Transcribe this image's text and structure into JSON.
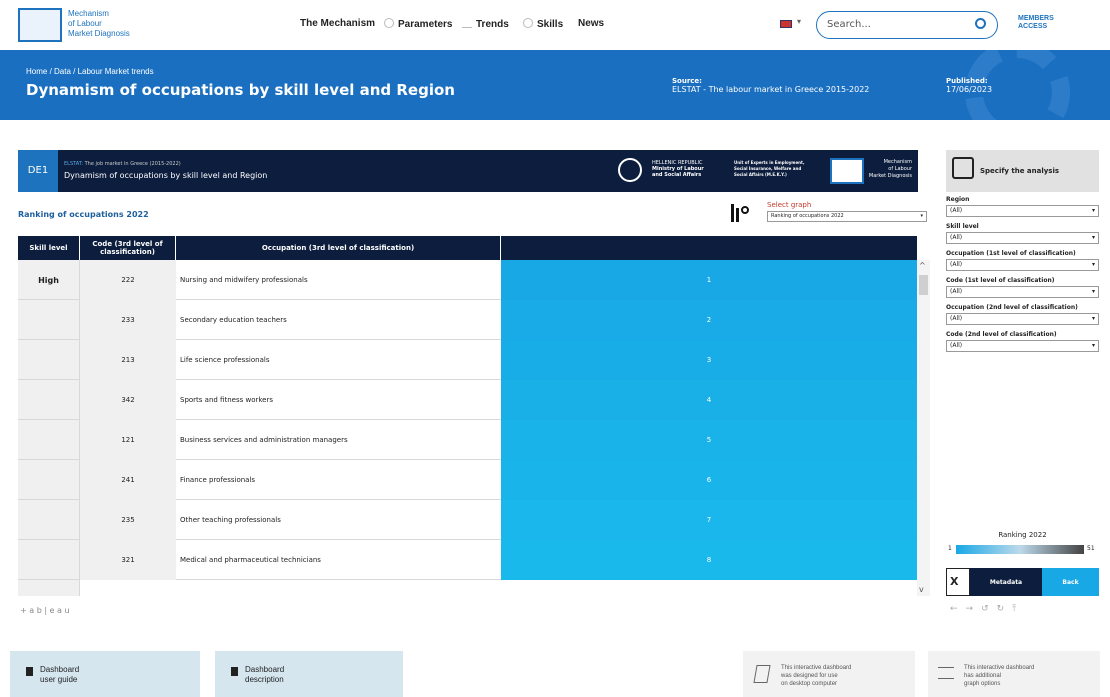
{
  "nav": {
    "logo_text": [
      "Mechanism",
      "of Labour",
      "Market Diagnosis"
    ],
    "links": [
      "The Mechanism",
      "Parameters",
      "Trends",
      "Skills",
      "News"
    ],
    "search_placeholder": "Search...",
    "members": [
      "MEMBERS",
      "ACCESS"
    ]
  },
  "banner": {
    "breadcrumb": "Home / Data / Labour Market trends",
    "title": "Dynamism of occupations by skill level and Region",
    "source_label": "Source:",
    "source_value": "ELSTAT - The labour market in Greece 2015-2022",
    "published_label": "Published:",
    "published_value": "17/06/2023"
  },
  "dashboard": {
    "code": "DE1",
    "subtitle_small_prefix": "ELSTAT:",
    "subtitle_small": "The job market in Greece (2015-2022)",
    "subtitle": "Dynamism of occupations by skill level and Region",
    "ministry": [
      "HELLENIC REPUBLIC",
      "Ministry of Labour",
      "and Social Affairs"
    ],
    "unit": [
      "Unit of Experts in Employment,",
      "Social Insurance, Welfare and",
      "Social Affairs (M.E.K.Y.)"
    ],
    "mech_logo": [
      "Mechanism",
      "of Labour",
      "Market Diagnosis"
    ],
    "ranking_title": "Ranking of occupations 2022",
    "select_graph_label": "Select graph",
    "select_graph_value": "Ranking of occupations 2022",
    "columns": [
      "Skill level",
      "Code (3rd level of classification)",
      "Occupation (3rd level of classification)"
    ],
    "skill_level": "High",
    "rows": [
      {
        "code": "222",
        "occupation": "Nursing and midwifery professionals",
        "rank": "1"
      },
      {
        "code": "233",
        "occupation": "Secondary education teachers",
        "rank": "2"
      },
      {
        "code": "213",
        "occupation": "Life science professionals",
        "rank": "3"
      },
      {
        "code": "342",
        "occupation": "Sports and fitness workers",
        "rank": "4"
      },
      {
        "code": "121",
        "occupation": "Business services and administration managers",
        "rank": "5"
      },
      {
        "code": "241",
        "occupation": "Finance professionals",
        "rank": "6"
      },
      {
        "code": "235",
        "occupation": "Other teaching professionals",
        "rank": "7"
      },
      {
        "code": "321",
        "occupation": "Medical and pharmaceutical technicians",
        "rank": "8"
      }
    ],
    "specify": "Specify the analysis",
    "filters": [
      {
        "label": "Region",
        "value": "(All)"
      },
      {
        "label": "Skill level",
        "value": "(All)"
      },
      {
        "label": "Occupation (1st level of classification)",
        "value": "(All)"
      },
      {
        "label": "Code (1st level of classification)",
        "value": "(All)"
      },
      {
        "label": "Occupation (2nd level of classification)",
        "value": "(All)"
      },
      {
        "label": "Code (2nd level of classification)",
        "value": "(All)"
      }
    ],
    "legend_title": "Ranking 2022",
    "legend_min": "1",
    "legend_max": "51",
    "metadata": "Metadata",
    "back": "Back",
    "tableau": "+ a b | e a u"
  },
  "bottom": {
    "guide": [
      "Dashboard",
      "user guide"
    ],
    "description": [
      "Dashboard",
      "description"
    ],
    "desktop_note": [
      "This interactive dashboard",
      "was designed for use",
      "on desktop computer"
    ],
    "options_note": [
      "This interactive dashboard",
      "has additional",
      "graph options"
    ]
  },
  "colors": {
    "brand": "#1a6fc0",
    "navy": "#0c1d3d",
    "bar": "#19a8e6"
  }
}
